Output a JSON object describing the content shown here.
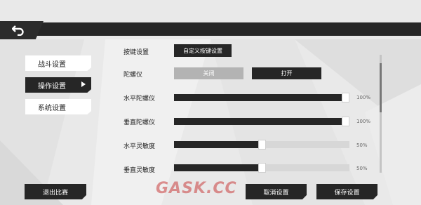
{
  "header": {
    "back_icon": "back-arrow-icon"
  },
  "sidebar": {
    "items": [
      {
        "label": "战斗设置",
        "active": false
      },
      {
        "label": "操作设置",
        "active": true
      },
      {
        "label": "系统设置",
        "active": false
      }
    ]
  },
  "settings": {
    "keybind": {
      "label": "按键设置",
      "button": "自定义按键设置"
    },
    "gyro": {
      "label": "陀螺仪",
      "off_label": "关闭",
      "on_label": "打开"
    },
    "sliders": [
      {
        "label": "水平陀螺仪",
        "value": 100,
        "display": "100%"
      },
      {
        "label": "垂直陀螺仪",
        "value": 100,
        "display": "100%"
      },
      {
        "label": "水平灵敏度",
        "value": 50,
        "display": "50%"
      },
      {
        "label": "垂直灵敏度",
        "value": 50,
        "display": "50%"
      }
    ]
  },
  "footer": {
    "exit_label": "退出比赛",
    "cancel_label": "取消设置",
    "save_label": "保存设置"
  },
  "watermark": "GASK.CC",
  "colors": {
    "panel_dark": "#262626",
    "background": "#e9e9e9",
    "toggle_off": "#b3b3b3"
  }
}
